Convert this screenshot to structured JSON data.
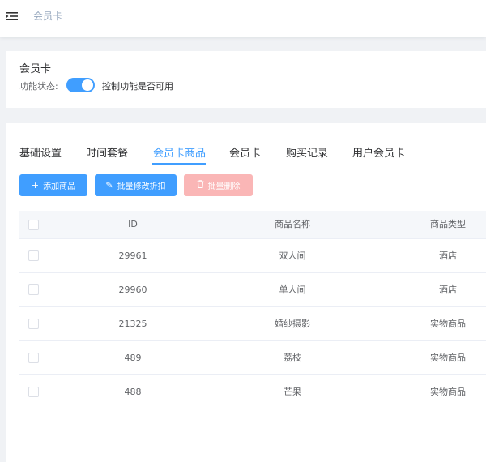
{
  "header": {
    "menu_icon": "hamburger-fold-icon",
    "breadcrumb": "会员卡"
  },
  "card": {
    "title": "会员卡",
    "status_label": "功能状态:",
    "status_on": true,
    "status_text": "控制功能是否可用"
  },
  "tabs": [
    {
      "label": "基础设置"
    },
    {
      "label": "时间套餐"
    },
    {
      "label": "会员卡商品"
    },
    {
      "label": "会员卡"
    },
    {
      "label": "购买记录"
    },
    {
      "label": "用户会员卡"
    }
  ],
  "active_tab": 2,
  "toolbar": {
    "add_label": "添加商品",
    "edit_label": "批量修改折扣",
    "delete_label": "批量删除"
  },
  "table": {
    "headers": [
      "ID",
      "商品名称",
      "商品类型"
    ],
    "rows": [
      {
        "id": "29961",
        "name": "双人间",
        "type": "酒店"
      },
      {
        "id": "29960",
        "name": "单人间",
        "type": "酒店"
      },
      {
        "id": "21325",
        "name": "婚纱摄影",
        "type": "实物商品"
      },
      {
        "id": "489",
        "name": "荔枝",
        "type": "实物商品"
      },
      {
        "id": "488",
        "name": "芒果",
        "type": "实物商品"
      }
    ]
  },
  "colors": {
    "primary": "#409eff",
    "danger_disabled": "#fab6b6",
    "background": "#f0f2f5"
  }
}
